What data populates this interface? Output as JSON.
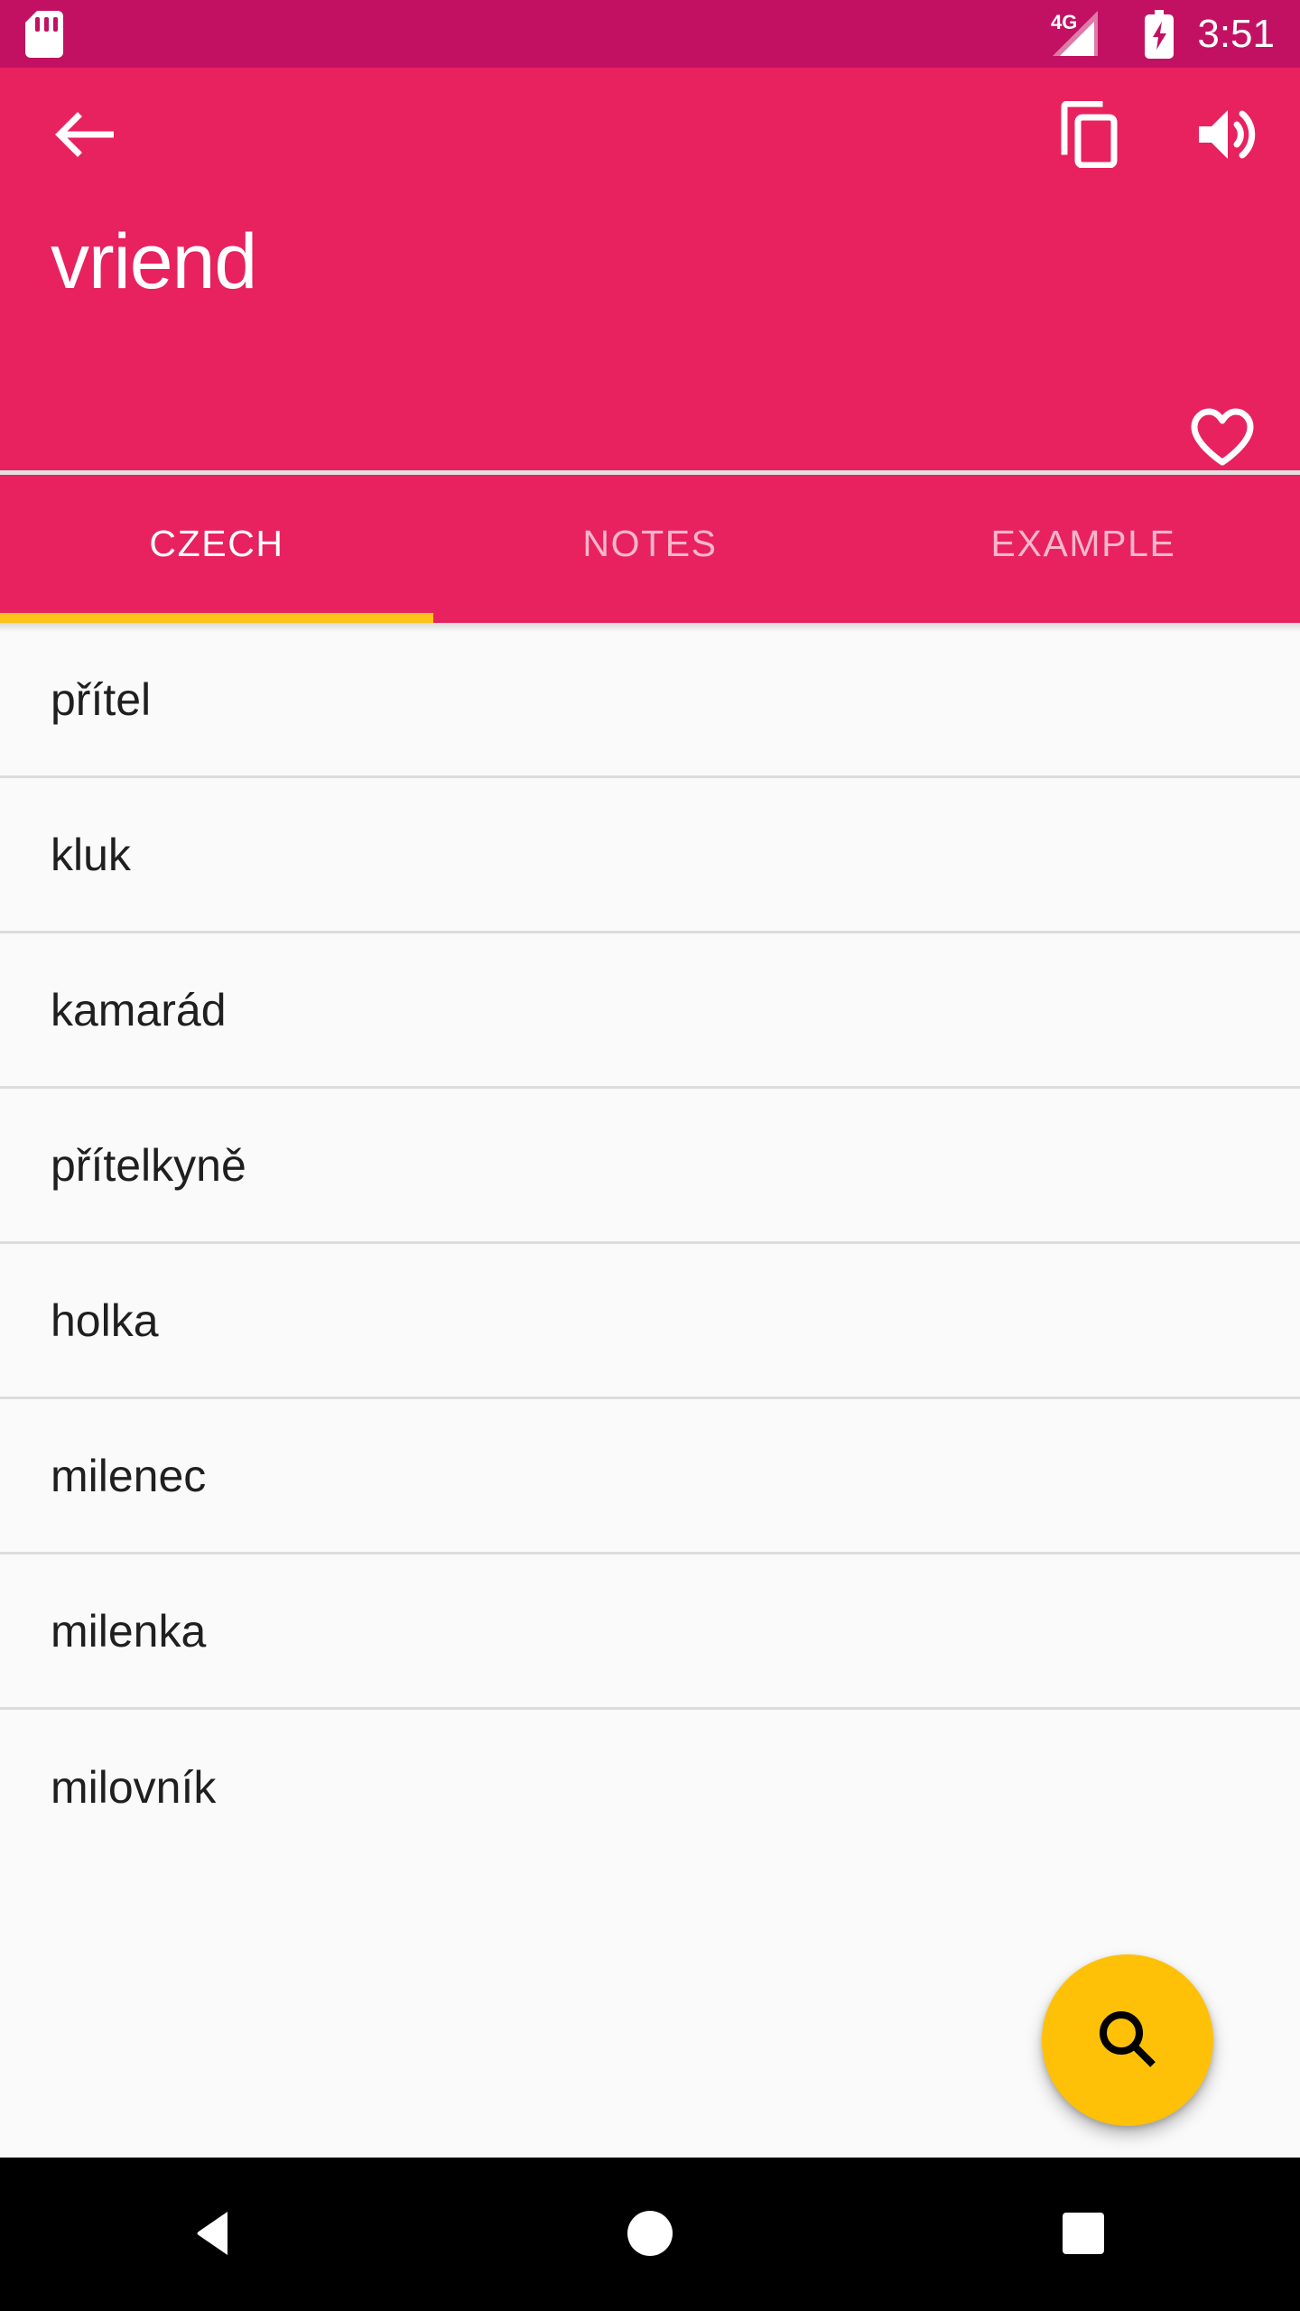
{
  "status_bar": {
    "sd_card_icon": "sd-card-icon",
    "network_label": "4G",
    "signal_icon": "signal-bars-icon",
    "battery_icon": "battery-charging-icon",
    "clock": "3:51",
    "background_color": "#C21162",
    "foreground_color": "#FFFFFF"
  },
  "header": {
    "background_color": "#E8215F",
    "back_icon": "back-arrow-icon",
    "title": "vriend",
    "actions": [
      {
        "name": "copy-icon",
        "label": "Copy"
      },
      {
        "name": "speaker-icon",
        "label": "Pronounce"
      }
    ],
    "favorite_icon": "heart-outline-icon",
    "favorite_active": false
  },
  "tabs": {
    "items": [
      {
        "label": "CZECH",
        "active": true
      },
      {
        "label": "NOTES",
        "active": false
      },
      {
        "label": "EXAMPLE",
        "active": false
      }
    ],
    "indicator_color": "#FFC21A",
    "active_color": "#FFFFFF",
    "inactive_color": "rgba(255,255,255,0.68)"
  },
  "translations": {
    "items": [
      {
        "word": "přítel"
      },
      {
        "word": "kluk"
      },
      {
        "word": "kamarád"
      },
      {
        "word": "přítelkyně"
      },
      {
        "word": "holka"
      },
      {
        "word": "milenec"
      },
      {
        "word": "milenka"
      },
      {
        "word": "milovník"
      }
    ],
    "background_color": "#FAFAFA",
    "divider_color": "#DCDCDC",
    "text_color": "#1F1F1F"
  },
  "fab": {
    "icon": "search-icon",
    "background_color": "#FFC107",
    "icon_color": "#000000"
  },
  "nav_bar": {
    "background_color": "#000000",
    "buttons": [
      {
        "name": "nav-back-icon"
      },
      {
        "name": "nav-home-icon"
      },
      {
        "name": "nav-recents-icon"
      }
    ]
  }
}
